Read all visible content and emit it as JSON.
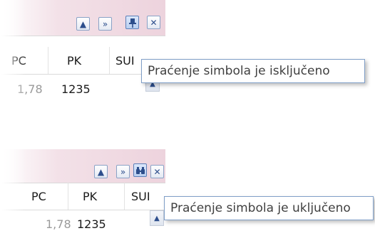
{
  "panel_top": {
    "toolbar": {
      "up_icon": "▲",
      "expand_icon": "»",
      "pin_icon": "📌",
      "close_icon": "✕"
    },
    "columns": [
      "PC",
      "PK",
      "SUI"
    ],
    "row": {
      "pc": "1,78",
      "pk": "1235"
    },
    "tooltip": "Praćenje simbola je isključeno"
  },
  "panel_bottom": {
    "toolbar": {
      "up_icon": "▲",
      "expand_icon": "»",
      "binoculars_icon": "👀",
      "close_icon": "✕"
    },
    "columns": [
      "PC",
      "PK",
      "SUI"
    ],
    "row": {
      "pc": "1,78",
      "pk": "1235"
    },
    "tooltip": "Praćenje simbola je uključeno"
  },
  "colors": {
    "titlebar": "#edd3dd",
    "button_border": "#8aa2c6",
    "tooltip_border": "#7f9ec7"
  }
}
